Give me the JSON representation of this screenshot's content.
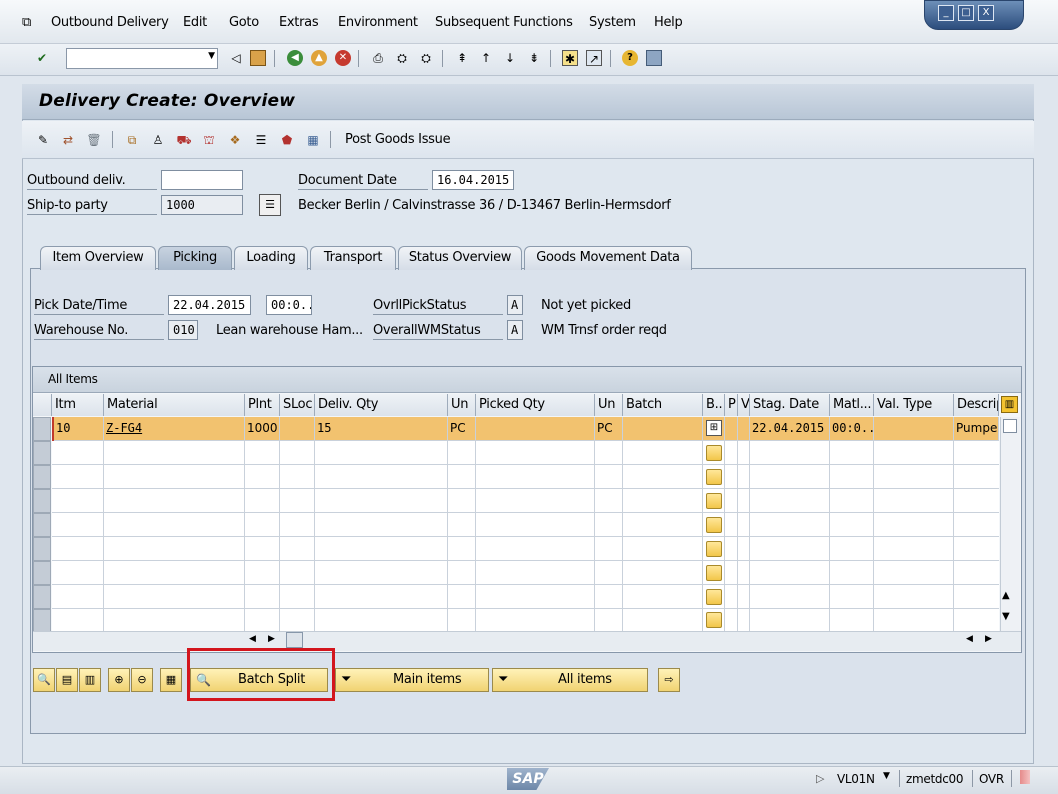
{
  "menu": {
    "items": [
      "Outbound Delivery",
      "Edit",
      "Goto",
      "Extras",
      "Environment",
      "Subsequent Functions",
      "System",
      "Help"
    ]
  },
  "window_controls": {
    "minimize": "_",
    "maximize": "□",
    "close": "X"
  },
  "toolbar": {
    "command_value": ""
  },
  "app": {
    "title": "Delivery  Create: Overview",
    "post_goods_issue": "Post Goods Issue"
  },
  "header": {
    "outbound_deliv_label": "Outbound deliv.",
    "outbound_deliv_value": "",
    "ship_to_label": "Ship-to party",
    "ship_to_value": "1000",
    "document_date_label": "Document Date",
    "document_date_value": "16.04.2015",
    "ship_to_address": "Becker Berlin / Calvinstrasse 36 / D-13467 Berlin-Hermsdorf"
  },
  "tabs": [
    "Item Overview",
    "Picking",
    "Loading",
    "Transport",
    "Status Overview",
    "Goods Movement Data"
  ],
  "picking": {
    "pick_date_label": "Pick Date/Time",
    "pick_date_value": "22.04.2015",
    "pick_time_value": "00:0..",
    "warehouse_label": "Warehouse No.",
    "warehouse_value": "010",
    "warehouse_desc": "Lean warehouse Ham...",
    "ovrl_pick_label": "OvrllPickStatus",
    "ovrl_pick_value": "A",
    "ovrl_pick_desc": "Not yet picked",
    "overall_wm_label": "OverallWMStatus",
    "overall_wm_value": "A",
    "overall_wm_desc": "WM Trnsf order reqd"
  },
  "table": {
    "title": "All Items",
    "columns": [
      "Itm",
      "Material",
      "Plnt",
      "SLoc",
      "Deliv. Qty",
      "Un",
      "Picked Qty",
      "Un",
      "Batch",
      "B..",
      "P",
      "V",
      "Stag. Date",
      "Matl...",
      "Val. Type",
      "Descrip"
    ],
    "rows": [
      {
        "itm": "10",
        "material": "Z-FG4",
        "plnt": "1000",
        "sloc": "",
        "deliv_qty": "15",
        "un": "PC",
        "picked_qty": "",
        "un2": "PC",
        "batch": "",
        "stag_date": "22.04.2015",
        "matl": "00:0..",
        "val_type": "",
        "descrip": "Pumpe"
      }
    ]
  },
  "buttons": {
    "batch_split": "Batch Split",
    "main_items": "Main items",
    "all_items": "All items"
  },
  "status_bar": {
    "logo": "SAP",
    "transaction": "VL01N",
    "server": "zmetdc00",
    "mode": "OVR"
  }
}
